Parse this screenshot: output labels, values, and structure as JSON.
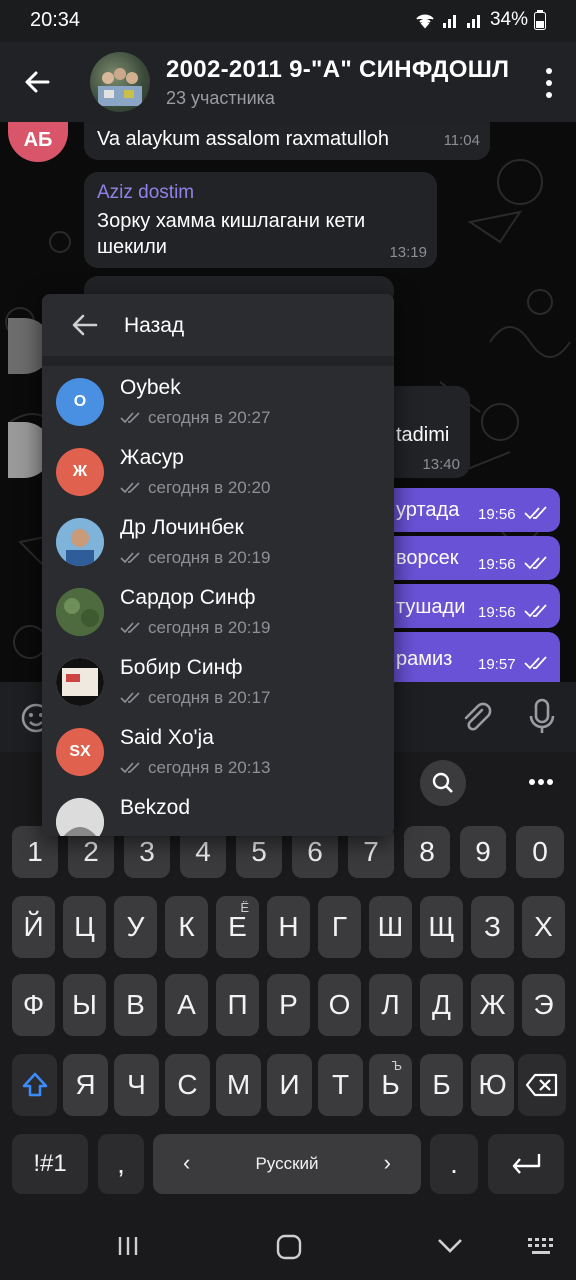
{
  "status": {
    "time": "20:34",
    "battery": "34%"
  },
  "header": {
    "title": "2002-2011 9-\"А\" СИНФДОШЛ",
    "subtitle": "23 участника"
  },
  "chat": {
    "msg1": {
      "text": "Va alaykum assalom raxmatulloh",
      "time": "11:04",
      "avatar": "АБ"
    },
    "msg2": {
      "sender": "Aziz dostim",
      "line1": "Зорку   хамма кишлагани кети",
      "line2": "шекили",
      "time": "13:19"
    },
    "msg3": {
      "text": "tadimi",
      "time": "13:40"
    },
    "out": [
      {
        "text": "уртада",
        "time": "19:56"
      },
      {
        "text": "ворсек",
        "time": "19:56"
      },
      {
        "text": "тушади",
        "time": "19:56"
      },
      {
        "text": "рамиз",
        "time": "19:57"
      }
    ]
  },
  "popup": {
    "back_label": "Назад",
    "readers": [
      {
        "name": "Oybek",
        "status": "сегодня в 20:27",
        "initials": "O",
        "color": "#4a90e2"
      },
      {
        "name": "Жасур",
        "status": "сегодня в 20:20",
        "initials": "Ж",
        "color": "#e0624e"
      },
      {
        "name": "Др Лочинбек",
        "status": "сегодня в 20:19",
        "initials": "",
        "color": "#3d7fb0"
      },
      {
        "name": "Сардор Синф",
        "status": "сегодня в 20:19",
        "initials": "",
        "color": "#5b6f4a"
      },
      {
        "name": "Бобир Синф",
        "status": "сегодня в 20:17",
        "initials": "",
        "color": "#e8e2d6"
      },
      {
        "name": "Said Xo'ja",
        "status": "сегодня в 20:13",
        "initials": "SX",
        "color": "#e0624e"
      },
      {
        "name": "Bekzod",
        "status": "",
        "initials": "",
        "color": "#cfcfcf"
      }
    ]
  },
  "keyboard": {
    "row_numbers": [
      "1",
      "2",
      "3",
      "4",
      "5",
      "6",
      "7",
      "8",
      "9",
      "0"
    ],
    "row1": [
      "Й",
      "Ц",
      "У",
      "К",
      "Е",
      "Н",
      "Г",
      "Ш",
      "Щ",
      "З",
      "Х"
    ],
    "row2": [
      "Ф",
      "Ы",
      "В",
      "А",
      "П",
      "Р",
      "О",
      "Л",
      "Д",
      "Ж",
      "Э"
    ],
    "row3": [
      "Я",
      "Ч",
      "С",
      "М",
      "И",
      "Т",
      "Ь",
      "Б",
      "Ю"
    ],
    "e_sup": "Ё",
    "soft_sup": "Ъ",
    "symbols_label": "!#1",
    "comma": ",",
    "language": "Русский",
    "period": "."
  }
}
